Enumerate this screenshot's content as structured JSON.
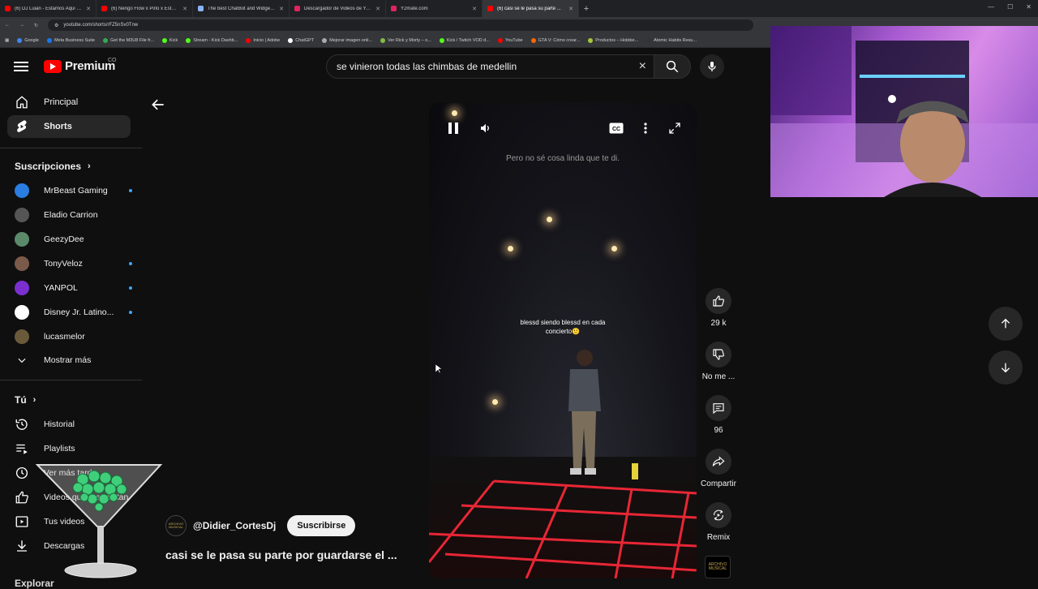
{
  "browser": {
    "tabs": [
      {
        "title": "(6) DJ Luian - Estamos Aqui ft. ...",
        "color": "#ff0000"
      },
      {
        "title": "(6) Ñengo Flow x Pirlo x Esteba...",
        "color": "#ff0000"
      },
      {
        "title": "The best ChatBot and Widgets...",
        "color": "#8ab4f8"
      },
      {
        "title": "Descargador de Videos de You...",
        "color": "#e0245e"
      },
      {
        "title": "Y2mate.com",
        "color": "#e0245e"
      },
      {
        "title": "(6) casi se le pasa su parte ...",
        "color": "#ff0000"
      }
    ],
    "new_tab": "+",
    "url": "youtube.com/shorts/rFZ5nSv0Tnw",
    "bookmarks": [
      {
        "label": "Google",
        "color": "#4285f4"
      },
      {
        "label": "Meta Business Suite",
        "color": "#1877f2"
      },
      {
        "label": "Get the M3U8 File fr...",
        "color": "#34a853"
      },
      {
        "label": "Kick",
        "color": "#53fc18"
      },
      {
        "label": "Stream - Kick Dashb...",
        "color": "#53fc18"
      },
      {
        "label": "Inicio | Adobe",
        "color": "#ff0000"
      },
      {
        "label": "ChatGPT",
        "color": "#ffffff"
      },
      {
        "label": "Mejorar imagen onli...",
        "color": "#aaaaaa"
      },
      {
        "label": "Ver Rick y Morty – o...",
        "color": "#7fbf3f"
      },
      {
        "label": "Kick / Twitch VOD d...",
        "color": "#53fc18"
      },
      {
        "label": "YouTube",
        "color": "#ff0000"
      },
      {
        "label": "GTA V: Cómo crear...",
        "color": "#ff6600"
      },
      {
        "label": "Productos – Hobbie...",
        "color": "#a4c639"
      },
      {
        "label": "Atomic Habits Resu...",
        "color": "#333333"
      }
    ]
  },
  "header": {
    "logo_text": "Premium",
    "logo_sup": "CO",
    "search_value": "se vinieron todas las chimbas de medellin",
    "clear_icon": "×"
  },
  "sidebar": {
    "main": [
      {
        "label": "Principal",
        "icon": "home-icon"
      },
      {
        "label": "Shorts",
        "icon": "shorts-icon"
      }
    ],
    "subscriptions_title": "Suscripciones",
    "subscriptions": [
      {
        "name": "MrBeast Gaming",
        "color": "#2a7de1",
        "new": true
      },
      {
        "name": "Eladio Carrion",
        "color": "#555555",
        "new": false
      },
      {
        "name": "GeezyDee",
        "color": "#5a8a6a",
        "new": false
      },
      {
        "name": "TonyVeloz",
        "color": "#7a5a4a",
        "new": true
      },
      {
        "name": "YANPOL",
        "color": "#7b2fd0",
        "new": true
      },
      {
        "name": "Disney Jr. Latino...",
        "color": "#ffffff",
        "new": true
      },
      {
        "name": "lucasmelor",
        "color": "#6a5a3a",
        "new": false
      }
    ],
    "show_more": "Mostrar más",
    "you_title": "Tú",
    "you_items": [
      {
        "label": "Historial",
        "icon": "history-icon"
      },
      {
        "label": "Playlists",
        "icon": "playlist-icon"
      },
      {
        "label": "Ver más tarde",
        "icon": "clock-icon"
      },
      {
        "label": "Videos que me gustan",
        "icon": "like-icon"
      },
      {
        "label": "Tus videos",
        "icon": "video-icon"
      },
      {
        "label": "Descargas",
        "icon": "download-icon"
      }
    ],
    "explore_title": "Explorar"
  },
  "video": {
    "lyric": "Pero no sé cosa linda que te di.",
    "caption": "blessd siendo blessd en cada concierto",
    "caption_emoji": "🙂",
    "channel_badge": "ARCHIVO MUSICAL",
    "channel": "@Didier_CortesDj",
    "subscribe": "Suscribirse",
    "title": "casi se le pasa su parte por guardarse el ..."
  },
  "actions": {
    "likes": "29 k",
    "dislike": "No me ...",
    "comments": "96",
    "share": "Compartir",
    "remix": "Remix"
  }
}
